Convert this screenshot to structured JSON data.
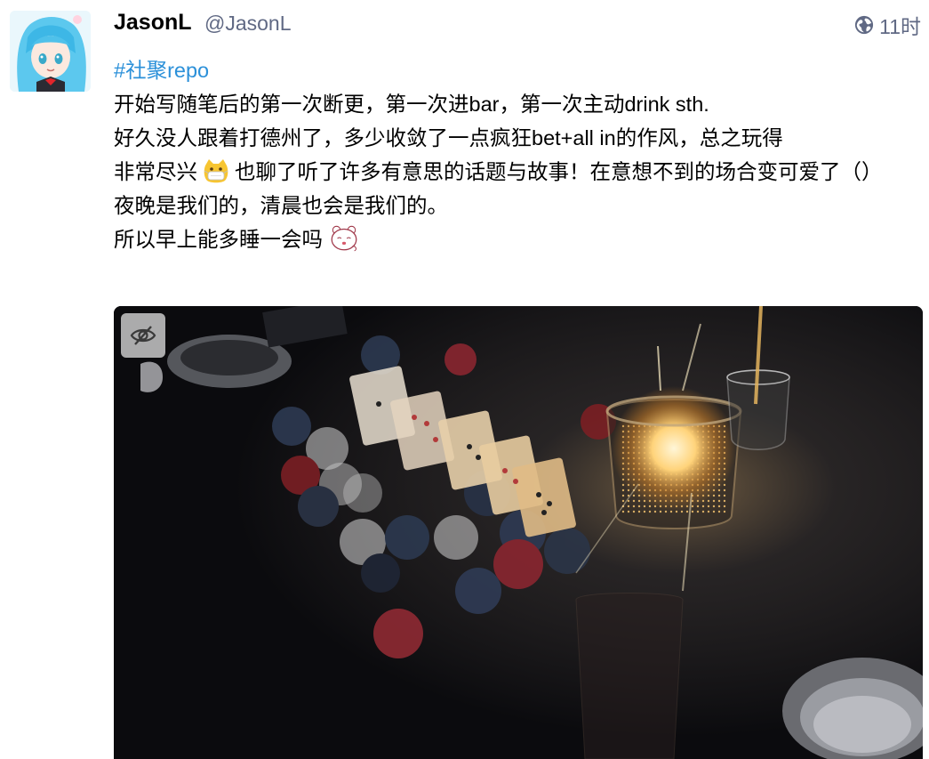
{
  "status": {
    "display_name": "JasonL",
    "handle": "@JasonL",
    "visibility_icon": "globe-icon",
    "relative_time": "11时",
    "hashtag": "#社聚repo",
    "lines": [
      "开始写随笔后的第一次断更，第一次进bar，第一次主动drink sth.",
      "好久没人跟着打德州了，多少收敛了一点疯狂bet+all in的作风，总之玩得",
      "非常尽兴",
      "也聊了听了许多有意思的话题与故事！在意想不到的场合变可爱了（）",
      "夜晚是我们的，清晨也会是我们的。",
      "所以早上能多睡一会吗"
    ],
    "emojis": [
      "cat-mask-emoji",
      "sleepy-bear-sticker"
    ]
  },
  "media": {
    "hide_button_icon": "eye-slash-icon"
  },
  "colors": {
    "hashtag": "#2b90d9",
    "muted": "#606984",
    "text": "#000000"
  }
}
